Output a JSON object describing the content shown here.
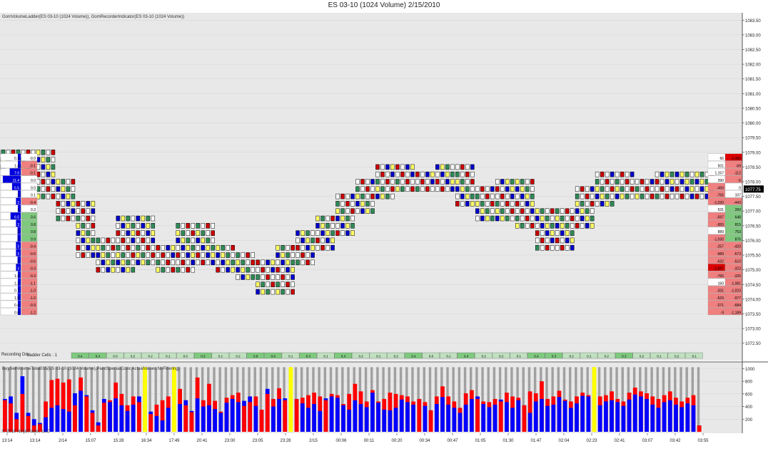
{
  "window": {
    "title": "ES 03-10 (1024 Volume)  2/15/2010"
  },
  "main_panel": {
    "indicator_label": "GomVolumeLadder(ES 03-10 (1024 Volume)), GomRecorderIndicator(ES 03-10 (1024 Volume))",
    "recording_label": "Recording Dire",
    "ladder_cells_label": "Ladder Cells : 1"
  },
  "volume_panel": {
    "indicator_label": "BuySellVolumeTotal035(ES 03-10 (1024 Volume),PaintSpecialColor,ActualValues,NoFiltering)",
    "copyright": "© 2010 NinjaTrader, LLC"
  },
  "colors": {
    "background": "#e8e8e8",
    "buy": "#0000ff",
    "sell": "#ff0000",
    "special": "#ffff00",
    "total": "#a0a0a0",
    "positive": "#7fc97f",
    "negative": "#f08080"
  },
  "chart_data": [
    {
      "type": "line",
      "series_style": "candlestick footprint (1024 volume bars)",
      "ylim": [
        1072.25,
        1083.75
      ],
      "y_ticks": [
        "1083.50",
        "1083.00",
        "1082.50",
        "1082.00",
        "1081.50",
        "1081.00",
        "1080.50",
        "1080.00",
        "1079.50",
        "1079.00",
        "1078.50",
        "1078.00",
        "1077.50",
        "1077.00",
        "1076.50",
        "1076.00",
        "1075.50",
        "1075.00",
        "1074.50",
        "1074.00",
        "1073.50",
        "1073.00",
        "1072.50"
      ],
      "x_ticks": [
        "13:14",
        "13:14",
        "2/14",
        "15:07",
        "15:28",
        "16:34",
        "17:49",
        "20:41",
        "23:00",
        "23:05",
        "23:28",
        "2/15",
        "00:06",
        "00:11",
        "00:20",
        "00:34",
        "00:47",
        "01:05",
        "01:30",
        "01:47",
        "02:04",
        "02:23",
        "02:41",
        "03:07",
        "03:42",
        "03:55"
      ],
      "price_path": [
        1078.75,
        1078.75,
        1077.75,
        1077.0,
        1075.75,
        1075.25,
        1076.5,
        1075.5,
        1075.25,
        1076.25,
        1075.5,
        1075.25,
        1075.0,
        1074.5,
        1075.5,
        1076.0,
        1076.5,
        1077.25,
        1077.75,
        1078.25,
        1078.0,
        1078.0,
        1078.25,
        1077.5,
        1077.0,
        1077.75,
        1076.75,
        1076.0,
        1076.75,
        1077.5,
        1078.0,
        1077.75,
        1077.75,
        1078.0,
        1077.75,
        1078.0
      ],
      "current_price": "1077.75",
      "left_ladder": [
        {
          "ask": "0.1",
          "delta": "-0.0"
        },
        {
          "ask": "1.4",
          "delta": "-0.1"
        },
        {
          "ask": "7.0",
          "delta": "-0.1"
        },
        {
          "ask": "11.4",
          "delta": "0.0"
        },
        {
          "ask": "5.5",
          "delta": "0.0"
        },
        {
          "ask": "1",
          "delta": "0.1"
        },
        {
          "ask": "3",
          "delta": "-0.4"
        },
        {
          "ask": "1",
          "delta": "0.3"
        },
        {
          "ask": "6.5",
          "delta": "0.6"
        },
        {
          "ask": "3",
          "delta": "0.8"
        },
        {
          "ask": "2",
          "delta": "0.8"
        },
        {
          "ask": "2",
          "delta": "0.9"
        },
        {
          "ask": "3",
          "delta": "-0.4"
        },
        {
          "ask": "3",
          "delta": "-0.6"
        },
        {
          "ask": "2",
          "delta": "-0.5"
        },
        {
          "ask": "3",
          "delta": "-0.3"
        },
        {
          "ask": "1.4",
          "delta": "-0.3"
        },
        {
          "ask": "1.2",
          "delta": "-1.1"
        },
        {
          "ask": "0.7",
          "delta": "-1.0"
        },
        {
          "ask": "1.9",
          "delta": "-1.0"
        },
        {
          "ask": "0.4",
          "delta": "-0.9"
        },
        {
          "ask": "0.8",
          "delta": "-1.2"
        }
      ],
      "right_ladder": [
        {
          "bid": "66",
          "delta": "-1,465"
        },
        {
          "bid": "501",
          "delta": "-69"
        },
        {
          "bid": "1,157",
          "delta": "-112"
        },
        {
          "bid": "390",
          "delta": "-5"
        },
        {
          "bid": "-493",
          "delta": "0"
        },
        {
          "bid": "-755",
          "delta": "107"
        },
        {
          "bid": "-1,030",
          "delta": "-443"
        },
        {
          "bid": "531",
          "delta": "260"
        },
        {
          "bid": "-597",
          "delta": "648"
        },
        {
          "bid": "-955",
          "delta": "815"
        },
        {
          "bid": "889",
          "delta": "753"
        },
        {
          "bid": "-1,030",
          "delta": "876"
        },
        {
          "bid": "-257",
          "delta": "-420"
        },
        {
          "bid": "-989",
          "delta": "-573"
        },
        {
          "bid": "-632",
          "delta": "-510"
        },
        {
          "bid": "-1,667",
          "delta": "-323"
        },
        {
          "bid": "-766",
          "delta": "-325"
        },
        {
          "bid": "160",
          "delta": "-1,081"
        },
        {
          "bid": "-331",
          "delta": "-1,023"
        },
        {
          "bid": "-529",
          "delta": "-977"
        },
        {
          "bid": "-271",
          "delta": "-684"
        },
        {
          "bid": "-9",
          "delta": "-1,189"
        }
      ],
      "recording_cells": [
        "0.4",
        "0.4",
        "0.0",
        "0.2",
        "0.2",
        "0.1",
        "0.0",
        "0.3",
        "0.1",
        "0.2",
        "0.8",
        "0.8",
        "0.1",
        "0.3",
        "0.1",
        "0.4",
        "0.2",
        "0.1",
        "0.2",
        "0.4",
        "0.0",
        "0.1",
        "0.4",
        "0.2",
        "0.2",
        "0.1",
        "0.4",
        "0.3",
        "0.2",
        "0.1",
        "0.2",
        "0.3",
        "0.2",
        "0.1",
        "0.2",
        "0.1"
      ]
    },
    {
      "type": "bar",
      "title": "BuySellVolumeTotal035",
      "ylim": [
        0,
        1050
      ],
      "y_ticks": [
        "1000",
        "800",
        "600",
        "400",
        "200"
      ],
      "series": [
        {
          "name": "total",
          "values": [
            1024,
            1024,
            1024,
            1024,
            1024,
            1024,
            1024,
            1024,
            1024,
            1024,
            1024,
            1024,
            1024,
            1024,
            1024,
            1024,
            1024,
            1024,
            1024,
            1024,
            1024,
            1024,
            1024,
            1024,
            1024,
            1024,
            1024,
            1024,
            1024,
            1024,
            1024,
            1024,
            1024,
            1024,
            1024,
            1024,
            1024,
            1024,
            1024,
            1024,
            1024,
            1024,
            1024,
            1024,
            1024,
            1024,
            1024,
            1024,
            1024,
            1024,
            1024,
            1024,
            1024,
            1024,
            1024,
            1024,
            1024,
            1024,
            1024,
            1024,
            1024,
            1024,
            1024,
            1024,
            1024,
            1024,
            1024,
            1024,
            1024,
            1024,
            1024,
            1024,
            1024,
            1024,
            1024,
            1024,
            1024,
            1024,
            1024,
            1024,
            1024,
            1024,
            1024,
            1024,
            1024,
            1024,
            1024,
            1024,
            1024,
            1024,
            1024,
            1024,
            1024,
            1024,
            1024,
            1024,
            1024,
            1024,
            1024,
            1024,
            1024,
            1024,
            1024,
            1024,
            1024,
            1024,
            1024,
            1024,
            1024,
            1024,
            1024,
            1024,
            1024,
            1024,
            1024,
            1024,
            1024,
            1024,
            1024,
            1024
          ]
        },
        {
          "name": "buy",
          "values": [
            520,
            560,
            300,
            880,
            300,
            200,
            140,
            230,
            380,
            420,
            360,
            320,
            610,
            650,
            580,
            340,
            150,
            520,
            470,
            530,
            420,
            330,
            430,
            560,
            400,
            320,
            250,
            180,
            380,
            480,
            440,
            500,
            330,
            530,
            400,
            420,
            360,
            300,
            460,
            520,
            470,
            490,
            560,
            410,
            350,
            680,
            400,
            520,
            530,
            580,
            520,
            450,
            380,
            440,
            330,
            530,
            560,
            540,
            420,
            350,
            500,
            440,
            390,
            620,
            460,
            350,
            340,
            380,
            510,
            470,
            430,
            520,
            410,
            340,
            440,
            550,
            430,
            380,
            300,
            430,
            520,
            560,
            440,
            390,
            430,
            510,
            470,
            380,
            500,
            420,
            300,
            480,
            520,
            410,
            430,
            550,
            490,
            380,
            450,
            570,
            560,
            400,
            420,
            480,
            500,
            470,
            410,
            510,
            590,
            560,
            520,
            430,
            380,
            470,
            500,
            430,
            390,
            450,
            420,
            100
          ]
        },
        {
          "name": "sell",
          "values": [
            500,
            450,
            200,
            600,
            250,
            100,
            120,
            480,
            820,
            840,
            780,
            830,
            420,
            860,
            560,
            300,
            100,
            460,
            500,
            780,
            600,
            420,
            560,
            470,
            720,
            280,
            430,
            500,
            560,
            860,
            680,
            420,
            310,
            860,
            500,
            760,
            490,
            320,
            540,
            580,
            620,
            410,
            470,
            560,
            350,
            600,
            520,
            690,
            500,
            470,
            520,
            540,
            580,
            620,
            560,
            500,
            600,
            580,
            440,
            600,
            760,
            640,
            480,
            660,
            480,
            520,
            620,
            600,
            580,
            560,
            480,
            520,
            470,
            340,
            560,
            720,
            560,
            480,
            380,
            610,
            660,
            520,
            480,
            470,
            520,
            480,
            620,
            560,
            540,
            420,
            640,
            610,
            800,
            520,
            560,
            650,
            510,
            480,
            560,
            620,
            580,
            520,
            560,
            580,
            640,
            520,
            480,
            620,
            700,
            640,
            610,
            560,
            520,
            580,
            640,
            540,
            480,
            540,
            580,
            100
          ]
        },
        {
          "name": "special",
          "values": [
            0,
            0,
            0,
            0,
            0,
            0,
            0,
            0,
            0,
            0,
            0,
            0,
            0,
            0,
            0,
            0,
            0,
            0,
            0,
            0,
            0,
            0,
            0,
            0,
            1024,
            0,
            0,
            0,
            0,
            1024,
            0,
            0,
            0,
            0,
            0,
            0,
            0,
            0,
            0,
            0,
            0,
            0,
            0,
            0,
            0,
            0,
            0,
            0,
            0,
            1024,
            0,
            0,
            0,
            0,
            0,
            0,
            0,
            0,
            0,
            0,
            0,
            0,
            0,
            0,
            0,
            0,
            0,
            0,
            0,
            0,
            0,
            0,
            0,
            0,
            0,
            0,
            0,
            0,
            0,
            0,
            0,
            0,
            0,
            0,
            0,
            0,
            0,
            0,
            0,
            0,
            0,
            0,
            0,
            0,
            0,
            0,
            0,
            0,
            0,
            0,
            0,
            1024,
            0,
            0,
            0,
            0,
            0,
            0,
            0,
            0,
            0,
            0,
            0,
            0,
            0,
            0,
            0,
            0,
            0,
            0
          ]
        }
      ]
    }
  ]
}
